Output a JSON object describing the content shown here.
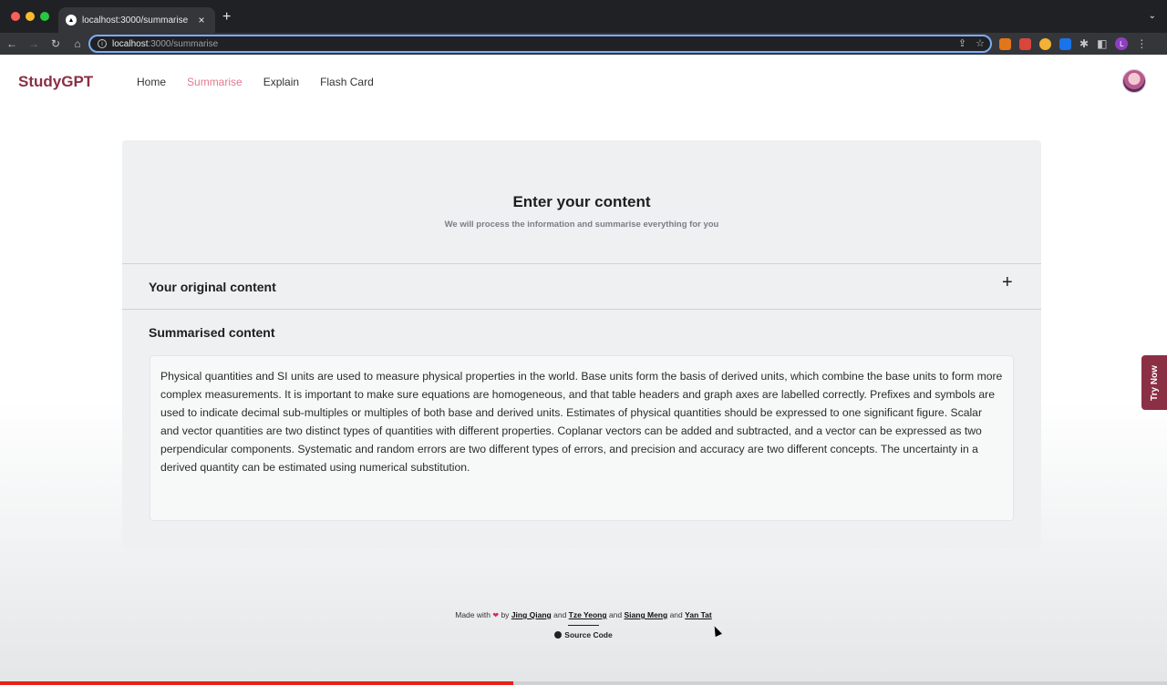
{
  "browser": {
    "tab_title": "localhost:3000/summarise",
    "tab_favicon": "▲",
    "close_glyph": "×",
    "new_tab_glyph": "+",
    "url_host": "localhost",
    "url_path": ":3000/summarise",
    "profile_initial": "L"
  },
  "nav": {
    "brand": "StudyGPT",
    "links": [
      "Home",
      "Summarise",
      "Explain",
      "Flash Card"
    ],
    "active_link": "Summarise"
  },
  "card": {
    "title": "Enter your content",
    "subtitle": "We will process the information and summarise everything for you",
    "original_section_title": "Your original content",
    "original_toggle": "+",
    "summary_section_title": "Summarised content",
    "summary_text": "Physical quantities and SI units are used to measure physical properties in the world. Base units form the basis of derived units, which combine the base units to form more complex measurements. It is important to make sure equations are homogeneous, and that table headers and graph axes are labelled correctly. Prefixes and symbols are used to indicate decimal sub-multiples or multiples of both base and derived units. Estimates of physical quantities should be expressed to one significant figure. Scalar and vector quantities are two distinct types of quantities with different properties. Coplanar vectors can be added and subtracted, and a vector can be expressed as two perpendicular components. Systematic and random errors are two different types of errors, and precision and accuracy are two different concepts. The uncertainty in a derived quantity can be estimated using numerical substitution."
  },
  "footer": {
    "made_with": "Made with",
    "by": "by",
    "and": "and",
    "authors": [
      "Jing Qiang",
      "Tze Yeong",
      "Siang Meng",
      "Yan Tat"
    ],
    "source_code": "Source Code"
  },
  "side_tab": {
    "label": "Try Now"
  },
  "video": {
    "played_fraction": 0.44
  },
  "colors": {
    "brand": "#8b2f45",
    "active_link": "#e07b8d",
    "heart": "#e0245e"
  },
  "icons": [
    "github-icon",
    "heart-icon",
    "plus-icon"
  ]
}
